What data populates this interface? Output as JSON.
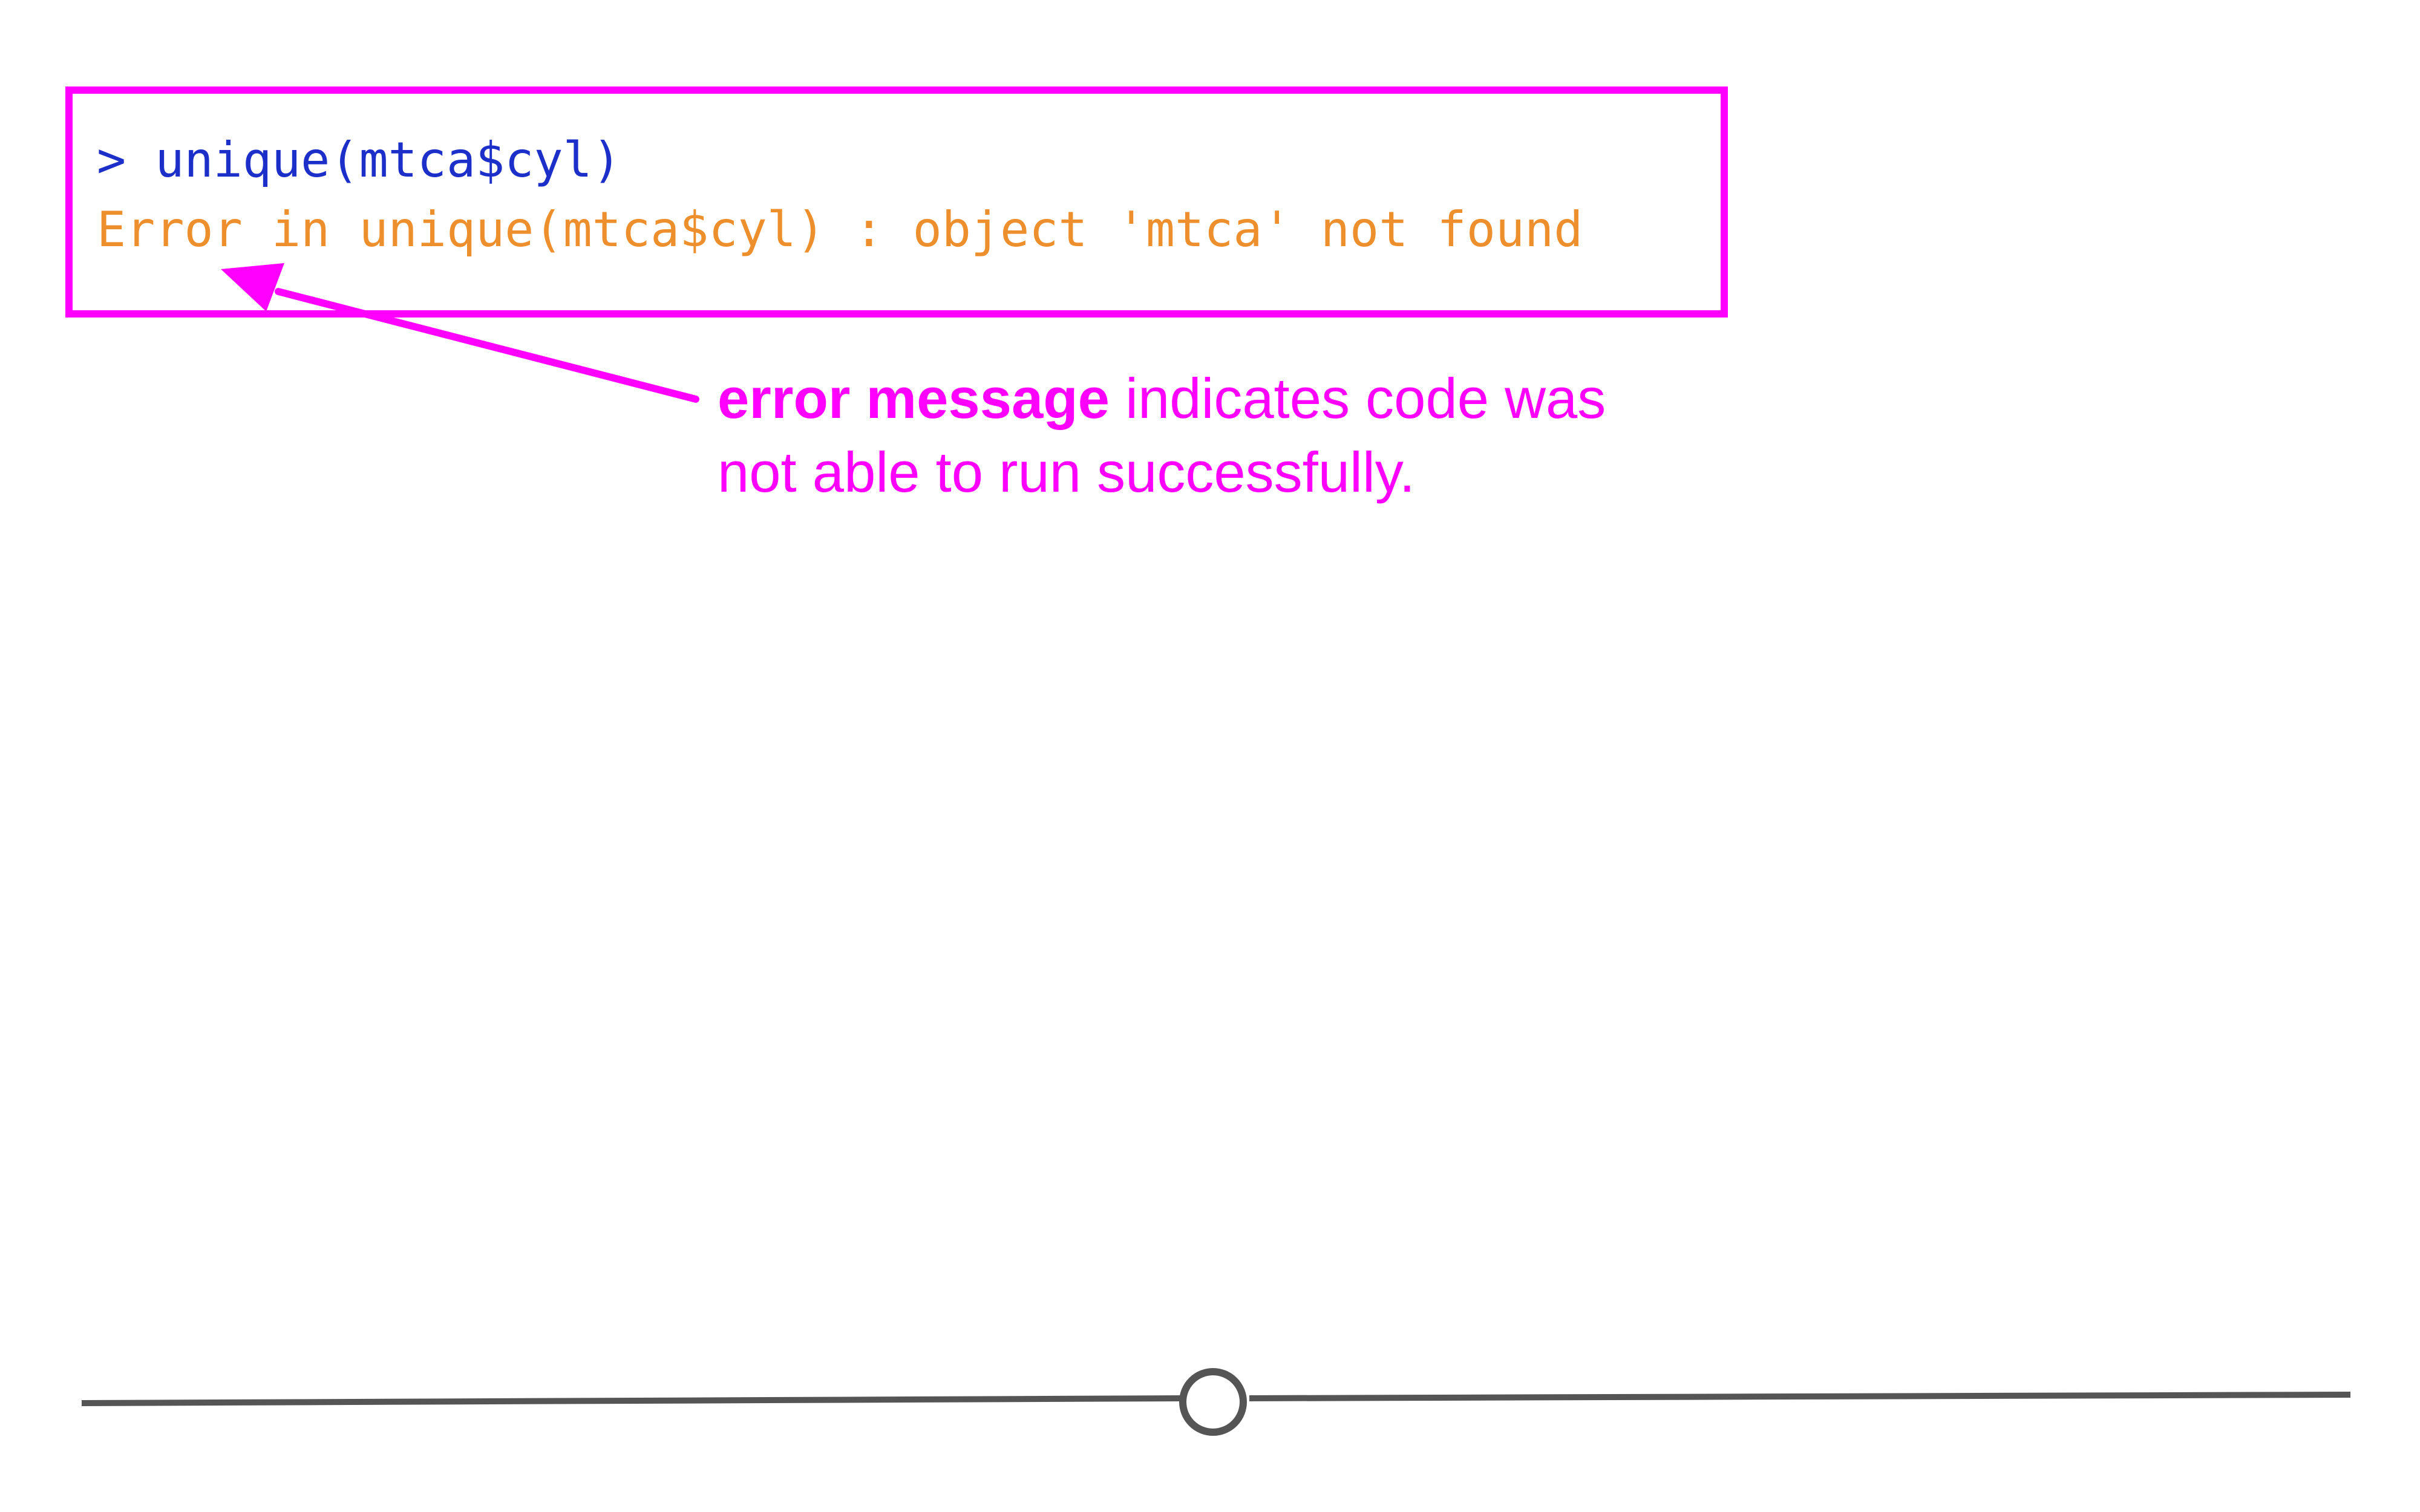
{
  "console": {
    "command": "> unique(mtca$cyl)",
    "error": "Error in unique(mtca$cyl) : object 'mtca' not found"
  },
  "annotation": {
    "bold_text": "error message",
    "text": " indicates code was not able to run successfully."
  },
  "colors": {
    "highlight": "#ff00ff",
    "command": "#1c2fc9",
    "error": "#ee8f2e",
    "slider": "#555555"
  },
  "icons": {
    "annotation_arrow": "arrow-icon",
    "slider_handle": "circle-handle-icon"
  }
}
